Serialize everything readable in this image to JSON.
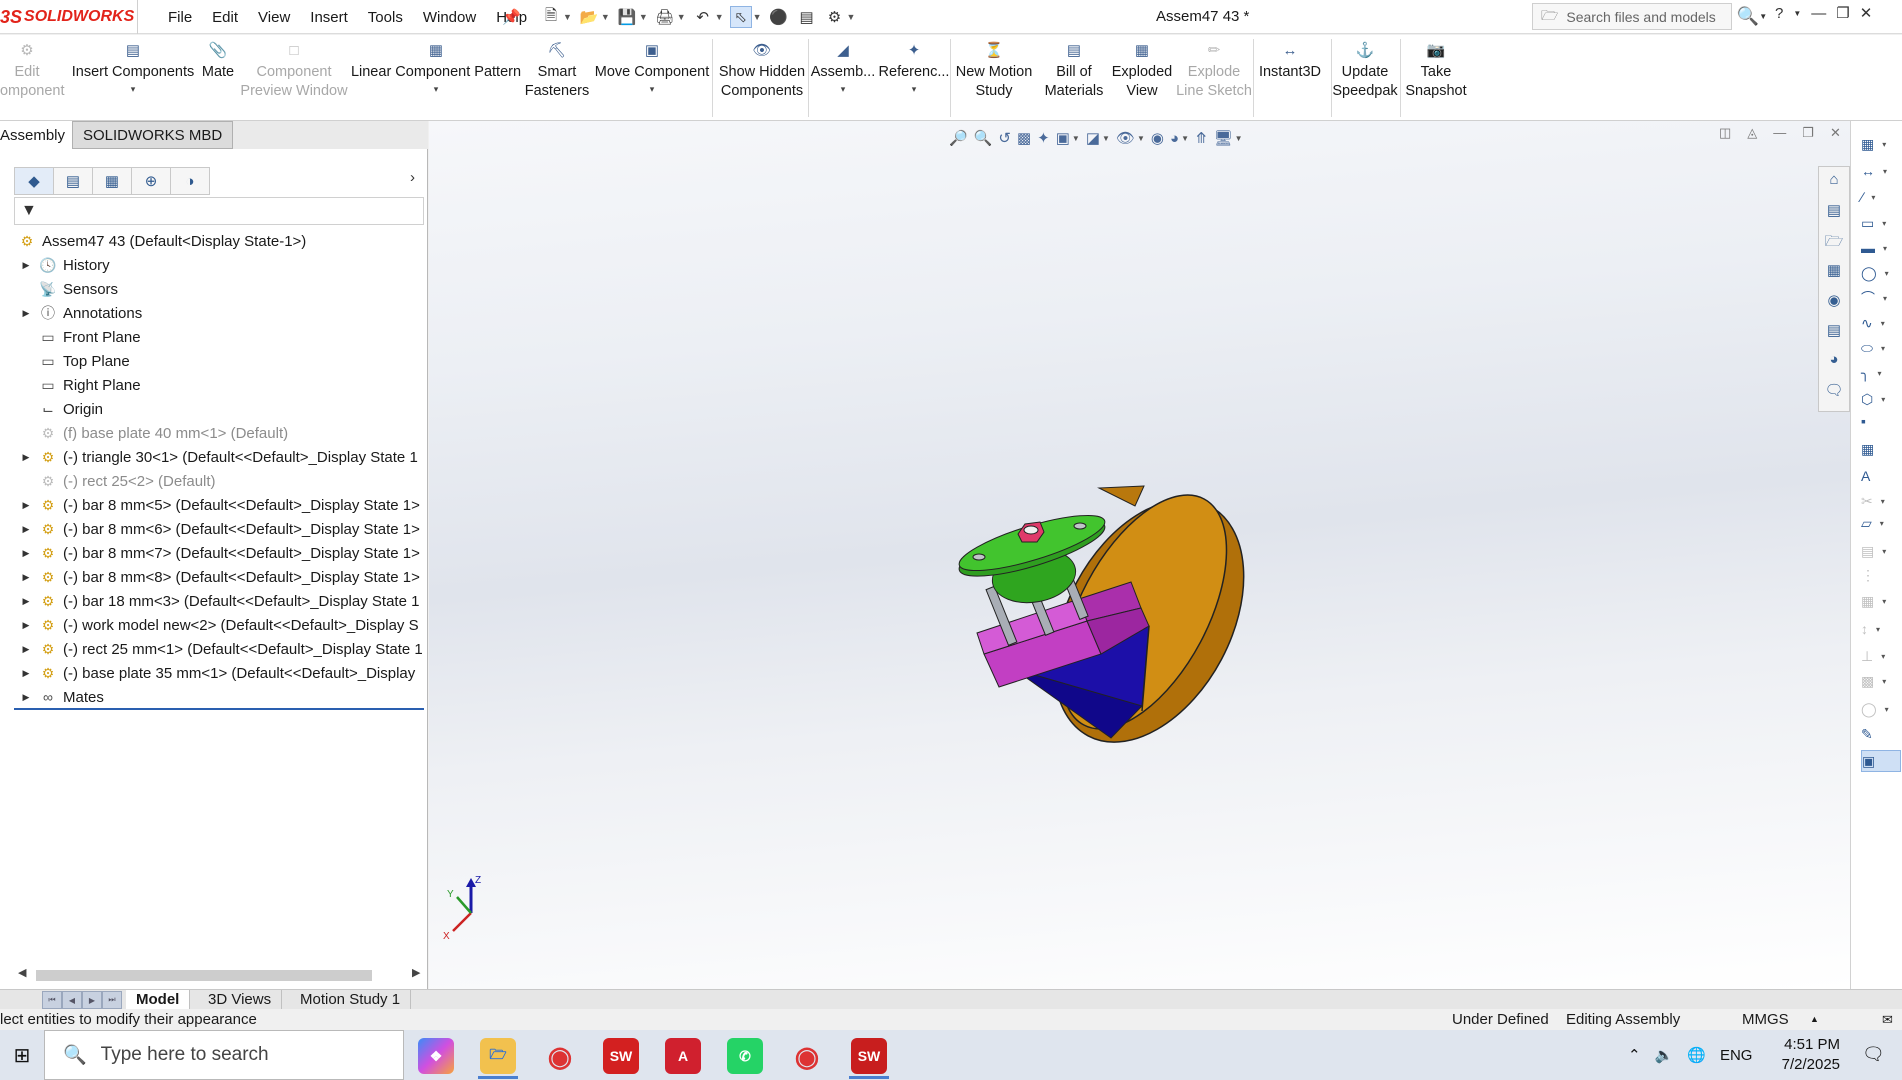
{
  "app": {
    "logo_ds": "3S",
    "logo_name": "SOLIDWORKS",
    "document_title": "Assem47 43 *",
    "menu": [
      "File",
      "Edit",
      "View",
      "Insert",
      "Tools",
      "Window",
      "Help"
    ],
    "search_placeholder": "Search files and models"
  },
  "commands": [
    {
      "label": "Edit\nComponent",
      "enabled": false,
      "dropdown": false
    },
    {
      "label": "Insert Components",
      "enabled": true,
      "dropdown": true
    },
    {
      "label": "Mate",
      "enabled": true,
      "dropdown": false
    },
    {
      "label": "Component\nPreview Window",
      "enabled": false,
      "dropdown": false
    },
    {
      "label": "Linear Component Pattern",
      "enabled": true,
      "dropdown": true
    },
    {
      "label": "Smart\nFasteners",
      "enabled": true,
      "dropdown": false
    },
    {
      "label": "Move Component",
      "enabled": true,
      "dropdown": true
    },
    {
      "label": "Show Hidden\nComponents",
      "enabled": true,
      "dropdown": false
    },
    {
      "label": "Assemb...",
      "enabled": true,
      "dropdown": true
    },
    {
      "label": "Referenc...",
      "enabled": true,
      "dropdown": true
    },
    {
      "label": "New Motion\nStudy",
      "enabled": true,
      "dropdown": false
    },
    {
      "label": "Bill of\nMaterials",
      "enabled": true,
      "dropdown": false
    },
    {
      "label": "Exploded\nView",
      "enabled": true,
      "dropdown": false
    },
    {
      "label": "Explode\nLine Sketch",
      "enabled": false,
      "dropdown": false
    },
    {
      "label": "Instant3D",
      "enabled": true,
      "dropdown": false
    },
    {
      "label": "Update\nSpeedpak",
      "enabled": true,
      "dropdown": false
    },
    {
      "label": "Take\nSnapshot",
      "enabled": true,
      "dropdown": false
    }
  ],
  "tabs": {
    "assembly": "Assembly",
    "mbd": "SOLIDWORKS MBD"
  },
  "tree": {
    "root": "Assem47 43  (Default<Display State-1>)",
    "items": [
      {
        "label": "History",
        "icon": "history-icon",
        "expandable": true,
        "suppressed": false
      },
      {
        "label": "Sensors",
        "icon": "sensors-icon",
        "expandable": false,
        "suppressed": false
      },
      {
        "label": "Annotations",
        "icon": "annotations-icon",
        "expandable": true,
        "suppressed": false
      },
      {
        "label": "Front Plane",
        "icon": "plane-icon",
        "expandable": false,
        "suppressed": false
      },
      {
        "label": "Top Plane",
        "icon": "plane-icon",
        "expandable": false,
        "suppressed": false
      },
      {
        "label": "Right Plane",
        "icon": "plane-icon",
        "expandable": false,
        "suppressed": false
      },
      {
        "label": "Origin",
        "icon": "origin-icon",
        "expandable": false,
        "suppressed": false
      },
      {
        "label": "(f) base plate 40 mm<1> (Default)",
        "icon": "part-icon",
        "expandable": false,
        "suppressed": true
      },
      {
        "label": "(-) triangle 30<1> (Default<<Default>_Display State 1",
        "icon": "part-icon",
        "expandable": true,
        "suppressed": false
      },
      {
        "label": "(-) rect 25<2> (Default)",
        "icon": "part-icon",
        "expandable": false,
        "suppressed": true
      },
      {
        "label": "(-) bar 8 mm<5> (Default<<Default>_Display State 1>",
        "icon": "part-icon",
        "expandable": true,
        "suppressed": false
      },
      {
        "label": "(-) bar 8 mm<6> (Default<<Default>_Display State 1>",
        "icon": "part-icon",
        "expandable": true,
        "suppressed": false
      },
      {
        "label": "(-) bar 8 mm<7> (Default<<Default>_Display State 1>",
        "icon": "part-icon",
        "expandable": true,
        "suppressed": false
      },
      {
        "label": "(-) bar 8 mm<8> (Default<<Default>_Display State 1>",
        "icon": "part-icon",
        "expandable": true,
        "suppressed": false
      },
      {
        "label": "(-) bar 18 mm<3> (Default<<Default>_Display State 1",
        "icon": "part-icon",
        "expandable": true,
        "suppressed": false
      },
      {
        "label": "(-) work model new<2> (Default<<Default>_Display S",
        "icon": "part-icon",
        "expandable": true,
        "suppressed": false
      },
      {
        "label": "(-) rect 25 mm<1> (Default<<Default>_Display State 1",
        "icon": "part-icon",
        "expandable": true,
        "suppressed": false
      },
      {
        "label": "(-) base plate 35 mm<1> (Default<<Default>_Display",
        "icon": "part-icon",
        "expandable": true,
        "suppressed": false
      },
      {
        "label": "Mates",
        "icon": "mates-icon",
        "expandable": true,
        "suppressed": false
      }
    ]
  },
  "bottom_tabs": [
    "Model",
    "3D Views",
    "Motion Study 1"
  ],
  "status": {
    "message": "lect entities to modify their appearance",
    "definition": "Under Defined",
    "mode": "Editing Assembly",
    "units": "MMGS"
  },
  "triad": {
    "x": "X",
    "y": "Y",
    "z": "Z"
  },
  "taskbar": {
    "search_placeholder": "Type here to search",
    "language": "ENG",
    "time": "4:51 PM",
    "date": "7/2/2025",
    "apps": [
      "copilot-icon",
      "file-explorer-icon",
      "chrome-icon",
      "solidworks-icon",
      "autocad-icon",
      "whatsapp-icon",
      "chrome-profile-icon",
      "solidworks-2016-icon"
    ]
  },
  "colors": {
    "accent": "#2a5fb0",
    "brand_red": "#e2231a",
    "base_plate": "#c8860f",
    "triangle": "#1c0fa8",
    "rect": "#c23fc3",
    "top_plate": "#3fbf2a",
    "bars": "#9aa0a8",
    "nut": "#e03a6a"
  }
}
